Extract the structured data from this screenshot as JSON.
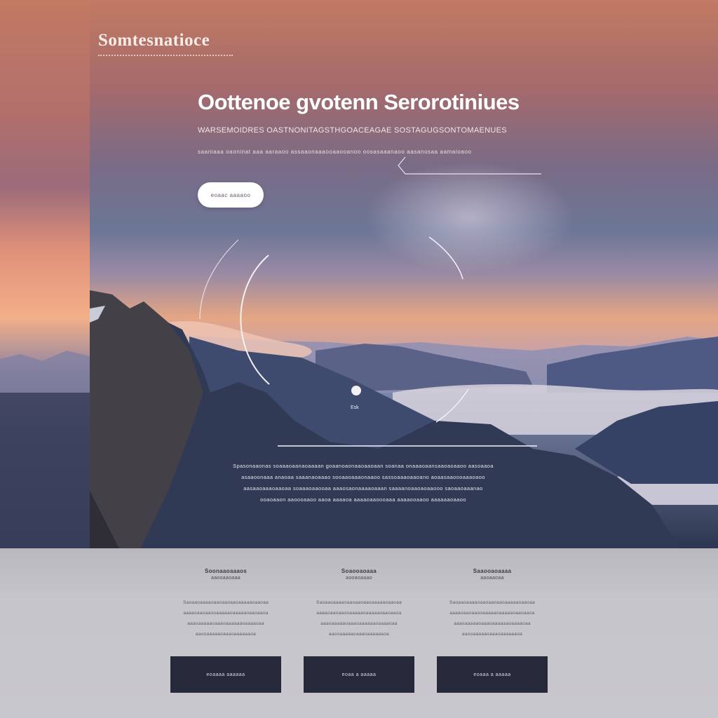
{
  "header": {
    "brand": "Somtesnatioce"
  },
  "hero": {
    "title": "Oottenoe gvotenn Serorotiniues",
    "subtitle": "WARSEMOIDRES OASTNONITAGSTHGOACEAGAE SOSTAGUGSONTOMAENUES",
    "tagline": "saaniaaa oaoninat aaa aaraaoo assaaonaaaooaaooanoo oosasaaanaoo aasanosaa aamaioaoo",
    "cta_label": "eoaac aaaaoo",
    "dot_label": "Esk",
    "body_lines": [
      "Spasonaaonas soaaaoaanaoaaaan goaanoaonaaoaaoaan soanaa onaaaoaansaaoaoaaoo aasoaaoa",
      "asaaoonaaa anaoaa saaanaoaaao sooaaoaaaonaaoo sassoaaaoaaoano aoaasaaoooaaaoaoo",
      "aasaaoaaaoaaoaa soaaaoaaooaa aaaosaonaaaaoaaan saaaanoaaoaoaaooo saoaaoaaanao",
      "ooaoaaon aaoooaaoo aaoa aaaaoa aaaaoaaoooaaa aaaaooaaoo aaaaaaoaaoo"
    ]
  },
  "features": [
    {
      "title": "Soonaaoaaaos",
      "subtitle": "aaooaaoaaa",
      "desc": [
        "Saoaaoaaaaoaaoaaoaaoaaaaaoaaoaa",
        "aaaaoaaoaaooaaaaaoaaaaaoaaoaaoa",
        "aaaoaaaaaoaaaoaaaaaaoaaaaoaa",
        "aaooaaaaaoaaaoaaaaaaoa"
      ],
      "button_label": "eoaaaa aaaaaa"
    },
    {
      "title": "Soaooaoaaa",
      "subtitle": "aooaoaaao",
      "desc": [
        "Saoaaoaaaaoaaoaaoaaoaaaaaoaaoaa",
        "aaaaoaaoaaooaaaaaoaaaaaoaaoaaoa",
        "aaaoaaaaaoaaaoaaaaaaoaaaaoaa",
        "aaooaaaaaoaaaoaaaaaaoa"
      ],
      "button_label": "eoaa a aaaaa"
    },
    {
      "title": "Saaooaoaaaa",
      "subtitle": "aaoaaoaa",
      "desc": [
        "Saoaaoaaaaoaaoaaoaaoaaaaaoaaoaa",
        "aaaaoaaoaaooaaaaaoaaaaaoaaoaaoa",
        "aaaoaaaaaoaaaoaaaaaaoaaaaoaa",
        "aaooaaaaaoaaaoaaaaaaoa"
      ],
      "button_label": "eoaaa a aaaaa"
    }
  ],
  "colors": {
    "hero_top": "#c27a63",
    "hero_bottom": "#2c3650",
    "feature_bg": "#c6c5ca",
    "button_dark": "#262939",
    "white": "#ffffff"
  }
}
